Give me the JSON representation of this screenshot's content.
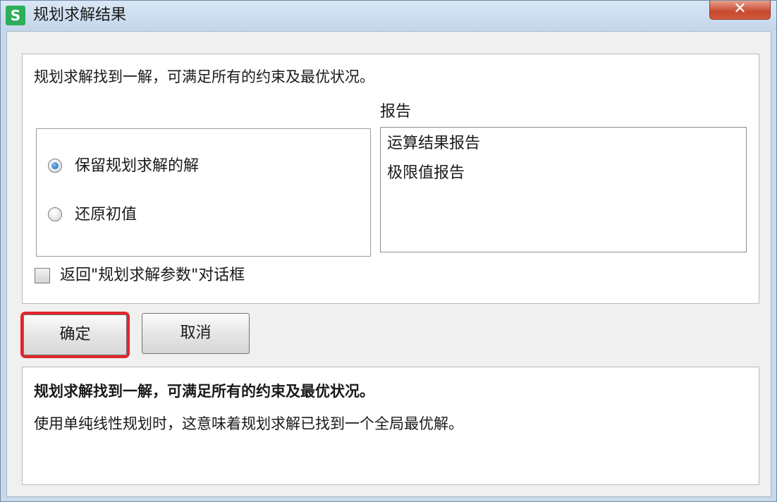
{
  "window": {
    "title": "规划求解结果",
    "app_icon_letter": "S",
    "close_glyph": "✕",
    "accent_color": "#2eae58",
    "highlight_color": "#e2262b"
  },
  "dialog": {
    "message": "规划求解找到一解，可满足所有的约束及最优状况。",
    "options": [
      {
        "label": "保留规划求解的解",
        "checked": true
      },
      {
        "label": "还原初值",
        "checked": false
      }
    ],
    "reports": {
      "title": "报告",
      "items": [
        "运算结果报告",
        "极限值报告"
      ]
    },
    "return_checkbox": {
      "label": "返回\"规划求解参数\"对话框",
      "checked": false
    }
  },
  "buttons": {
    "ok_label": "确定",
    "cancel_label": "取消"
  },
  "info": {
    "headline": "规划求解找到一解，可满足所有的约束及最优状况。",
    "description": "使用单纯线性规划时，这意味着规划求解已找到一个全局最优解。"
  }
}
